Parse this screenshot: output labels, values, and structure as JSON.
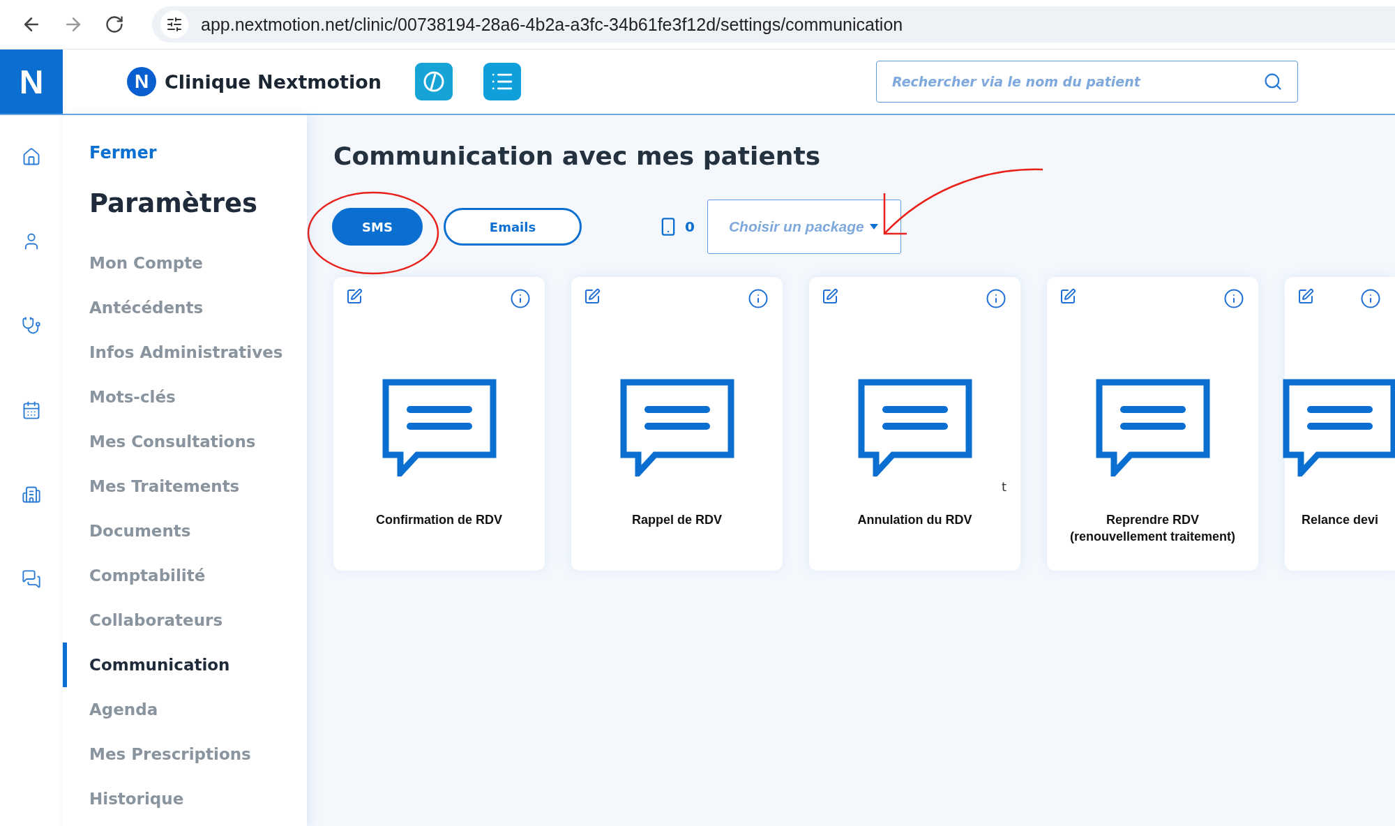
{
  "browser": {
    "url": "app.nextmotion.net/clinic/00738194-28a6-4b2a-a3fc-34b61fe3f12d/settings/communication"
  },
  "header": {
    "app_logo": "N",
    "brand_mark": "N",
    "brand": "Clinique Nextmotion",
    "search": {
      "placeholder": "Rechercher via le nom du patient"
    }
  },
  "rail": {
    "items": [
      {
        "kind": "home"
      },
      {
        "kind": "patient"
      },
      {
        "kind": "stethoscope"
      },
      {
        "kind": "calendar"
      },
      {
        "kind": "building"
      },
      {
        "kind": "chat"
      }
    ]
  },
  "settings_menu": {
    "close": "Fermer",
    "title": "Paramètres",
    "items": [
      {
        "label": "Mon Compte",
        "selected": false
      },
      {
        "label": "Antécédents",
        "selected": false
      },
      {
        "label": "Infos Administratives",
        "selected": false
      },
      {
        "label": "Mots-clés",
        "selected": false
      },
      {
        "label": "Mes Consultations",
        "selected": false
      },
      {
        "label": "Mes Traitements",
        "selected": false
      },
      {
        "label": "Documents",
        "selected": false
      },
      {
        "label": "Comptabilité",
        "selected": false
      },
      {
        "label": "Collaborateurs",
        "selected": false
      },
      {
        "label": "Communication",
        "selected": true
      },
      {
        "label": "Agenda",
        "selected": false
      },
      {
        "label": "Mes Prescriptions",
        "selected": false
      },
      {
        "label": "Historique",
        "selected": false
      }
    ]
  },
  "main": {
    "title": "Communication avec mes patients",
    "channels": [
      {
        "label": "SMS",
        "selected": true
      },
      {
        "label": "Emails",
        "selected": false
      }
    ],
    "sms_count": "0",
    "package_select": {
      "placeholder": "Choisir un package"
    },
    "templates": [
      {
        "title": "Confirmation de RDV"
      },
      {
        "title": "Rappel de RDV"
      },
      {
        "title": "Annulation du RDV",
        "note": "t"
      },
      {
        "title": "Reprendre RDV\n(renouvellement traitement)"
      },
      {
        "title": "Relance devi"
      }
    ]
  }
}
